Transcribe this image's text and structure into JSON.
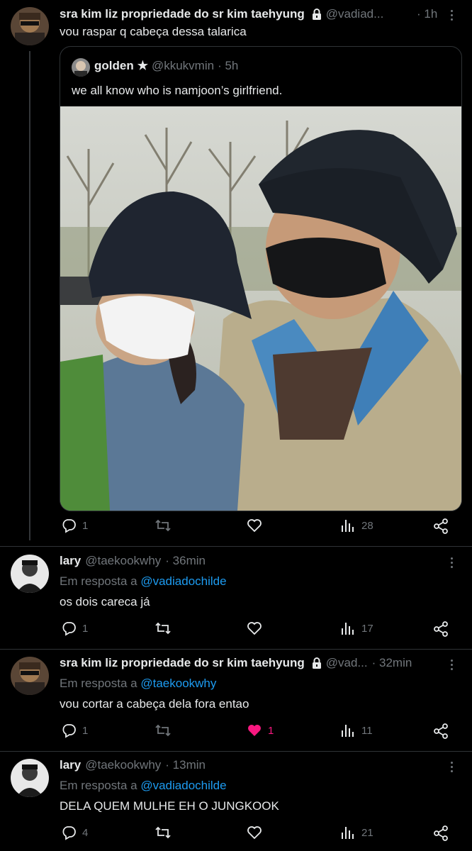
{
  "tweets": [
    {
      "author": "sra kim liz propriedade do sr kim taehyung",
      "handle": "@vadiad...",
      "time": "· 1h",
      "text": "vou raspar q cabeça dessa talarica",
      "quote": {
        "author": "golden",
        "star": "★",
        "handle": "@kkukvmin",
        "time": "· 5h",
        "text": "we all know who is namjoon’s girlfriend."
      },
      "stats": {
        "replies": "1",
        "retweets": "",
        "likes": "",
        "views": "28"
      }
    },
    {
      "author": "lary",
      "handle": "@taekookwhy",
      "time": "· 36min",
      "reply_prefix": "Em resposta a",
      "reply_to": "@vadiadochilde",
      "text": "os dois careca já",
      "stats": {
        "replies": "1",
        "retweets": "",
        "likes": "",
        "views": "17"
      }
    },
    {
      "author": "sra kim liz propriedade do sr kim taehyung",
      "handle": "@vad...",
      "time": "· 32min",
      "reply_prefix": "Em resposta a",
      "reply_to": "@taekookwhy",
      "text": "vou cortar a cabeça dela fora entao",
      "stats": {
        "replies": "1",
        "retweets": "",
        "likes": "1",
        "views": "11"
      }
    },
    {
      "author": "lary",
      "handle": "@taekookwhy",
      "time": "· 13min",
      "reply_prefix": "Em resposta a",
      "reply_to": "@vadiadochilde",
      "text": "DELA QUEM MULHE EH O JUNGKOOK",
      "stats": {
        "replies": "4",
        "retweets": "",
        "likes": "",
        "views": "21"
      }
    }
  ],
  "icons": {
    "reply": "reply-icon",
    "retweet": "retweet-icon",
    "like": "heart-icon",
    "views": "views-icon",
    "share": "share-icon",
    "more": "more-icon",
    "lock": "lock-icon"
  },
  "colors": {
    "background": "#000000",
    "text": "#e7e9ea",
    "muted": "#71767b",
    "link": "#1d9bf0",
    "like_active": "#f91880"
  }
}
